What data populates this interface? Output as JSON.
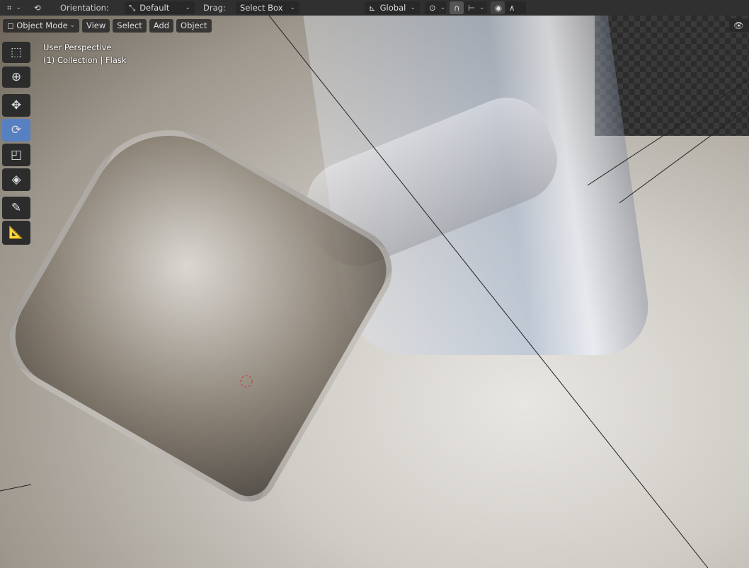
{
  "header": {
    "orientation_label": "Orientation:",
    "orientation_value": "Default",
    "drag_label": "Drag:",
    "drag_value": "Select Box",
    "transform_orientation": "Global"
  },
  "menu": {
    "mode": "Object Mode",
    "items": [
      "View",
      "Select",
      "Add",
      "Object"
    ]
  },
  "viewport": {
    "view_name": "User Perspective",
    "collection_info": "(1) Collection | Flask"
  },
  "tools": [
    "select-box",
    "cursor",
    "move",
    "rotate",
    "scale",
    "transform",
    "annotate",
    "measure"
  ],
  "active_tool": "rotate",
  "colors": {
    "header": "#303030",
    "active": "#5680c2"
  }
}
